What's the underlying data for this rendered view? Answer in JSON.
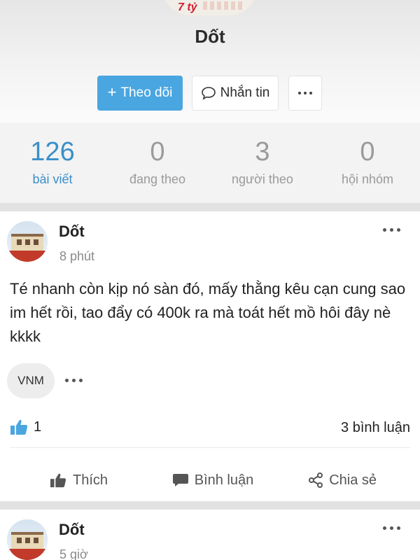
{
  "profile": {
    "cover_text": "7 tỷ",
    "name": "Dốt",
    "follow_label": "Theo dõi",
    "message_label": "Nhắn tin"
  },
  "stats": [
    {
      "count": "126",
      "label": "bài viết"
    },
    {
      "count": "0",
      "label": "đang theo"
    },
    {
      "count": "3",
      "label": "người theo"
    },
    {
      "count": "0",
      "label": "hội nhóm"
    }
  ],
  "colors": {
    "accent": "#4aa6e0",
    "active_stat": "#3a8fc9",
    "muted": "#9a9a9a"
  },
  "posts": [
    {
      "author": "Dốt",
      "time": "8 phút",
      "content": "Té nhanh còn kịp nó sàn đó, mấy thằng kêu cạn cung sao im hết rồi, tao đẩy có 400k ra mà toát hết mồ hôi đây nè kkkk",
      "tag": "VNM",
      "likes": "1",
      "comments": "3 bình luận",
      "actions": {
        "like": "Thích",
        "comment": "Bình luận",
        "share": "Chia sẻ"
      }
    },
    {
      "author": "Dốt",
      "time": "5 giờ"
    }
  ],
  "icons": [
    "plus-icon",
    "chat-bubble-icon",
    "more-icon",
    "thumbs-up-icon",
    "comment-icon",
    "share-icon"
  ]
}
